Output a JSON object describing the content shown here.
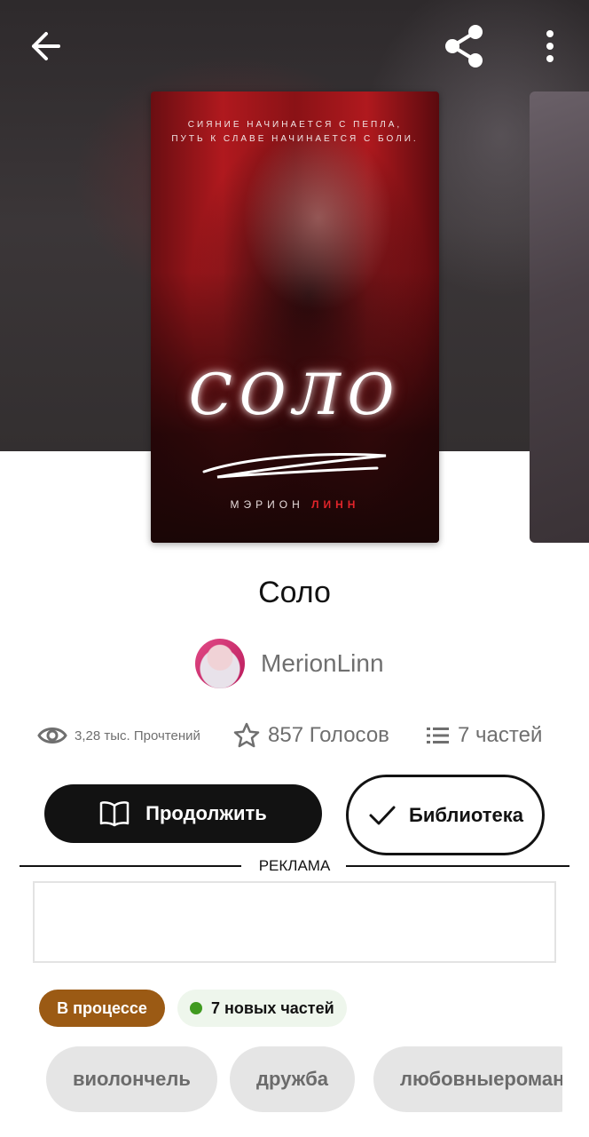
{
  "header": {
    "back_icon": "arrow-left-icon",
    "share_icon": "share-icon",
    "more_icon": "more-vertical-icon"
  },
  "cover": {
    "tagline_line1": "Сияние начинается с пепла,",
    "tagline_line2": "путь к славе начинается с боли.",
    "title": "СОЛО",
    "author_first": "МЭРИОН",
    "author_last": "ЛИНН",
    "accent_color": "#e0242a"
  },
  "book": {
    "title": "Соло",
    "author": "MerionLinn"
  },
  "stats": {
    "reads": "3,28 тыс. Прочтений",
    "votes": "857 Голосов",
    "parts": "7 частей"
  },
  "actions": {
    "continue_label": "Продолжить",
    "library_label": "Библиотека"
  },
  "ad": {
    "label": "РЕКЛАМА"
  },
  "status": {
    "state": "В процессе",
    "state_color": "#9b5a14",
    "new_parts": "7 новых частей",
    "new_dot_color": "#3f9a1f"
  },
  "tags": [
    "виолончель",
    "дружба",
    "любовныероман"
  ]
}
